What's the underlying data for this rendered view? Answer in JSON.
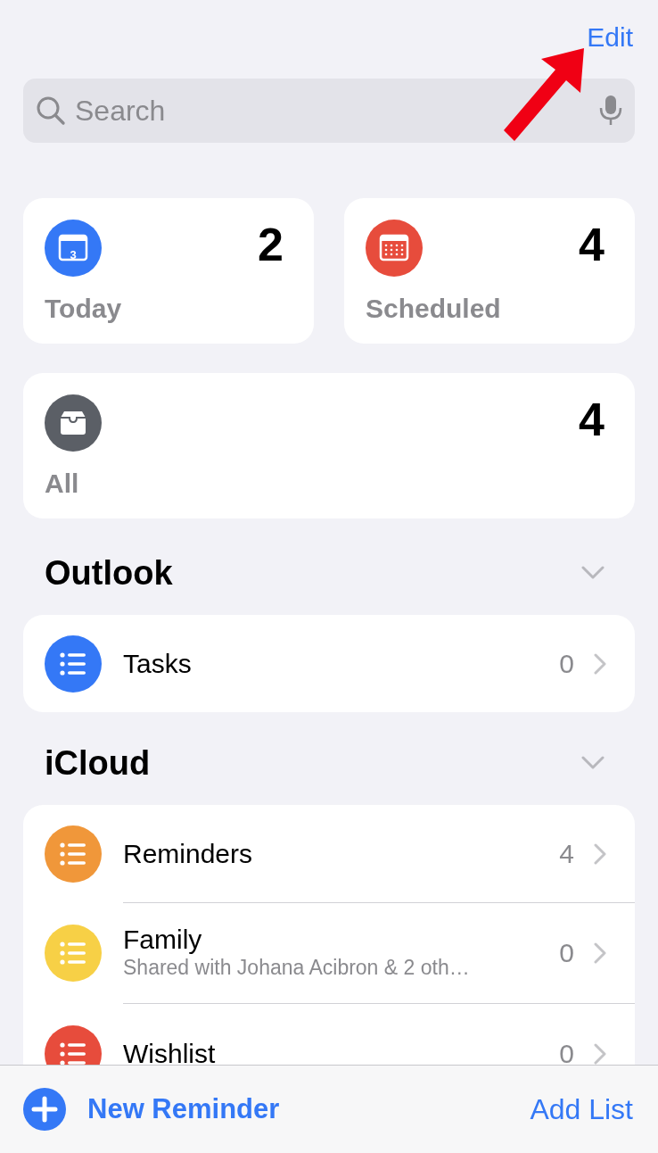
{
  "nav": {
    "edit": "Edit"
  },
  "search": {
    "placeholder": "Search"
  },
  "smart_lists": [
    {
      "kind": "today",
      "label": "Today",
      "count": "2",
      "color": "#3478f6",
      "day": "3"
    },
    {
      "kind": "scheduled",
      "label": "Scheduled",
      "count": "4",
      "color": "#e74c3c"
    },
    {
      "kind": "all",
      "label": "All",
      "count": "4",
      "color": "#5b5f66"
    }
  ],
  "sections": [
    {
      "title": "Outlook",
      "expanded": true,
      "lists": [
        {
          "name": "Tasks",
          "count": "0",
          "color": "#3478f6"
        }
      ]
    },
    {
      "title": "iCloud",
      "expanded": true,
      "lists": [
        {
          "name": "Reminders",
          "count": "4",
          "color": "#f0973a"
        },
        {
          "name": "Family",
          "subtitle": "Shared with Johana Acibron & 2 oth…",
          "count": "0",
          "color": "#f7d046"
        },
        {
          "name": "Wishlist",
          "count": "0",
          "color": "#e74c3c"
        }
      ]
    }
  ],
  "toolbar": {
    "new_reminder": "New Reminder",
    "add_list": "Add List"
  }
}
